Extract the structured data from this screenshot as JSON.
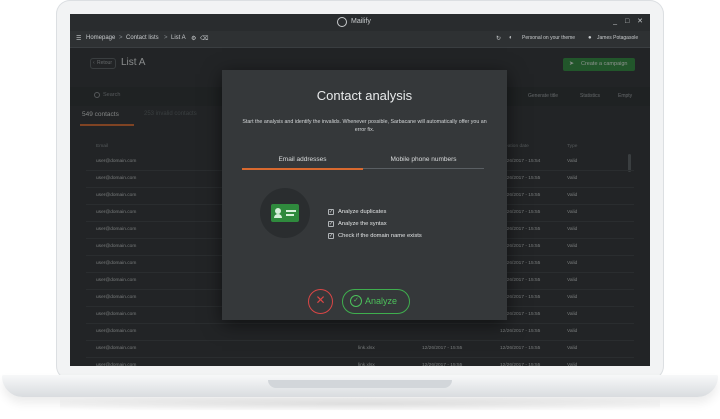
{
  "app": {
    "name": "Mailify",
    "window_controls": "_ □ ✕"
  },
  "nav": {
    "menu_icon": "menu-icon",
    "items": [
      "Homepage",
      "Contact lists",
      "List A"
    ],
    "separator": ">",
    "theme_label": "Personal on your theme",
    "user_name": "James Potagasole"
  },
  "header": {
    "back_label": "Retour",
    "title": "List A",
    "create_button": "Create a campaign"
  },
  "toolbar": {
    "search_placeholder": "Search",
    "actions": [
      "Generate title",
      "Statistics",
      "Empty"
    ]
  },
  "tabs": {
    "contacts": "549 contacts",
    "invalid": "253 invalid contacts"
  },
  "table": {
    "headers": [
      "Email",
      "",
      "",
      "Creation date",
      "Type"
    ],
    "rows": [
      [
        "user@domain.com",
        "",
        "",
        "12/26/2017 - 15:54",
        "Valid"
      ],
      [
        "user@domain.com",
        "",
        "",
        "12/26/2017 - 15:55",
        "Valid"
      ],
      [
        "user@domain.com",
        "",
        "",
        "12/26/2017 - 15:55",
        "Valid"
      ],
      [
        "user@domain.com",
        "",
        "",
        "12/26/2017 - 15:55",
        "Valid"
      ],
      [
        "user@domain.com",
        "",
        "",
        "12/26/2017 - 15:55",
        "Valid"
      ],
      [
        "user@domain.com",
        "",
        "",
        "12/26/2017 - 15:55",
        "Valid"
      ],
      [
        "user@domain.com",
        "",
        "",
        "12/26/2017 - 15:55",
        "Valid"
      ],
      [
        "user@domain.com",
        "",
        "",
        "12/26/2017 - 15:55",
        "Valid"
      ],
      [
        "user@domain.com",
        "",
        "",
        "12/26/2017 - 15:55",
        "Valid"
      ],
      [
        "user@domain.com",
        "",
        "",
        "12/26/2017 - 15:55",
        "Valid"
      ],
      [
        "user@domain.com",
        "",
        "",
        "12/26/2017 - 15:55",
        "Valid"
      ],
      [
        "user@domain.com",
        "link.xlsx",
        "12/26/2017 - 15:55",
        "12/26/2017 - 15:55",
        "Valid"
      ],
      [
        "user@domain.com",
        "link.xlsx",
        "12/26/2017 - 15:55",
        "12/26/2017 - 15:55",
        "Valid"
      ]
    ]
  },
  "modal": {
    "title": "Contact analysis",
    "description": "Start the analysis and identify the invalids. Whenever possible, Sarbacane will automatically offer you an error fix.",
    "tabs": [
      "Email addresses",
      "Mobile phone numbers"
    ],
    "options": [
      {
        "label": "Analyze duplicates",
        "checked": true
      },
      {
        "label": "Analyze the syntax",
        "checked": true
      },
      {
        "label": "Check if the domain name exists",
        "checked": true
      }
    ],
    "check_mark": "✓",
    "cancel_symbol": "✕",
    "analyze_label": "Analyze"
  },
  "colors": {
    "accent": "#d8692f",
    "success": "#3fae4e",
    "danger": "#d94646",
    "background": "#2e3133"
  }
}
